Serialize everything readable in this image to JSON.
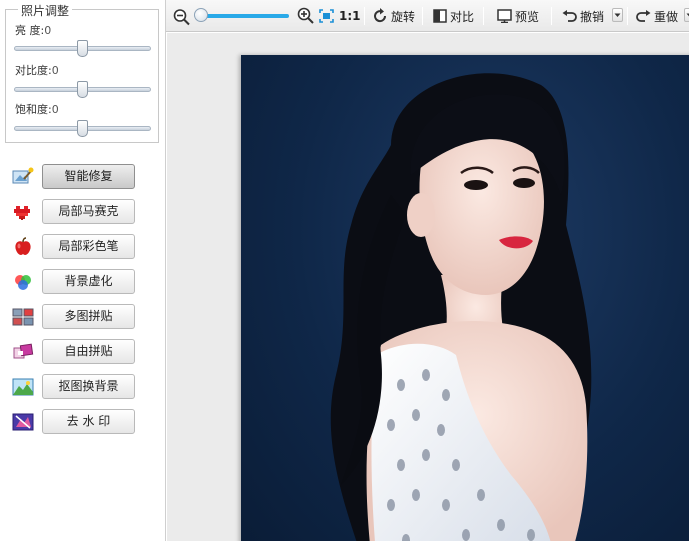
{
  "adjust": {
    "title": "照片调整",
    "sliders": [
      {
        "label": "亮  度:",
        "value": "0",
        "level": 0.5
      },
      {
        "label": "对比度:",
        "value": "0",
        "level": 0.5
      },
      {
        "label": "饱和度:",
        "value": "0",
        "level": 0.5
      }
    ]
  },
  "tools": [
    {
      "label": "智能修复",
      "icon": "magic-wand-icon",
      "active": true
    },
    {
      "label": "局部马赛克",
      "icon": "mosaic-heart-icon",
      "active": false
    },
    {
      "label": "局部彩色笔",
      "icon": "red-apple-icon",
      "active": false
    },
    {
      "label": "背景虚化",
      "icon": "color-blur-icon",
      "active": false
    },
    {
      "label": "多图拼贴",
      "icon": "grid-collage-icon",
      "active": false
    },
    {
      "label": "自由拼贴",
      "icon": "free-collage-icon",
      "active": false
    },
    {
      "label": "抠图换背景",
      "icon": "cutout-background-icon",
      "active": false
    },
    {
      "label": "去 水 印",
      "icon": "remove-watermark-icon",
      "active": false
    }
  ],
  "toolbar": {
    "zoom_level": 0.0,
    "actual_size": "1:1",
    "rotate": "旋转",
    "compare": "对比",
    "preview": "预览",
    "undo": "撤销",
    "redo": "重做"
  },
  "colors": {
    "accent": "#29a9e8",
    "photo_background": "#0f2748"
  }
}
